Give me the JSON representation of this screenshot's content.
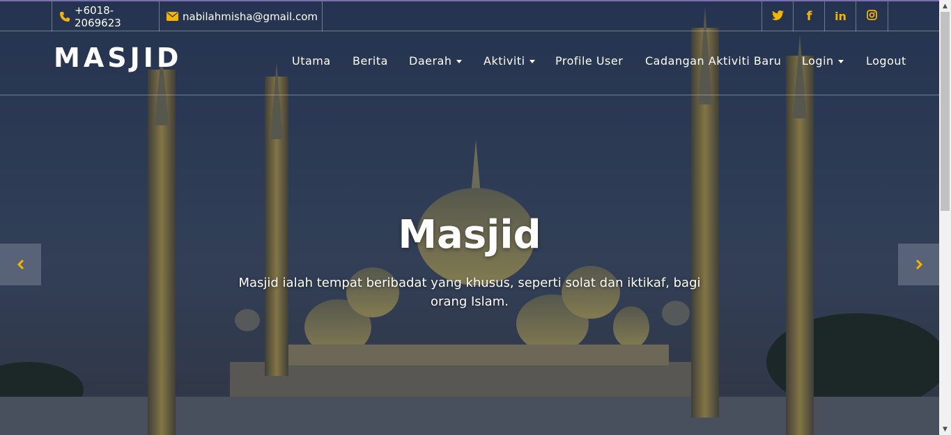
{
  "topbar": {
    "phone": "+6018-2069623",
    "email": "nabilahmisha@gmail.com",
    "phone_icon": "phone-icon",
    "email_icon": "envelope-icon",
    "social": [
      {
        "name": "twitter-icon",
        "glyph": "🐦"
      },
      {
        "name": "facebook-icon",
        "glyph": "f"
      },
      {
        "name": "linkedin-icon",
        "glyph": "in"
      },
      {
        "name": "instagram-icon",
        "glyph": "◎"
      }
    ]
  },
  "navbar": {
    "brand": "MASJID",
    "items": [
      {
        "label": "Utama",
        "dropdown": false
      },
      {
        "label": "Berita",
        "dropdown": false
      },
      {
        "label": "Daerah",
        "dropdown": true
      },
      {
        "label": "Aktiviti",
        "dropdown": true
      },
      {
        "label": "Profile User",
        "dropdown": false
      },
      {
        "label": "Cadangan Aktiviti Baru",
        "dropdown": false
      },
      {
        "label": "Login",
        "dropdown": true
      },
      {
        "label": "Logout",
        "dropdown": false
      }
    ]
  },
  "hero": {
    "title": "Masjid",
    "description": "Masjid ialah tempat beribadat yang khusus, seperti solat dan iktikaf, bagi orang Islam.",
    "prev_icon": "chevron-left-icon",
    "next_icon": "chevron-right-icon"
  },
  "colors": {
    "accent": "#f4b400",
    "overlay": "#2b3a56"
  }
}
